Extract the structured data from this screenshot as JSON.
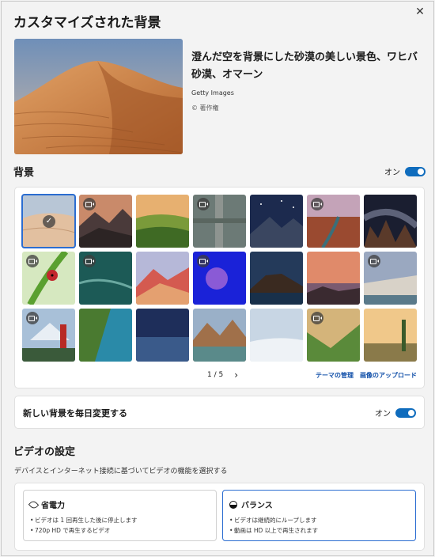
{
  "title": "カスタマイズされた背景",
  "close_label": "✕",
  "hero": {
    "caption": "澄んだ空を背景にした砂漠の美しい景色、ワヒバ砂漠、オマーン",
    "credit": "Getty Images",
    "copyright": "© 著作権"
  },
  "background": {
    "label": "背景",
    "toggle_label": "オン",
    "toggle_on": true,
    "tiles": [
      {
        "id": "desert",
        "video": false,
        "selected": true
      },
      {
        "id": "misty-mountains",
        "video": true
      },
      {
        "id": "green-hills",
        "video": false
      },
      {
        "id": "bridge-aerial",
        "video": true
      },
      {
        "id": "starry-mountain",
        "video": false
      },
      {
        "id": "canyon-river",
        "video": true
      },
      {
        "id": "milky-way-rocks",
        "video": false
      },
      {
        "id": "ladybug",
        "video": true
      },
      {
        "id": "ocean-aerial",
        "video": true
      },
      {
        "id": "rainbow-mountains",
        "video": false
      },
      {
        "id": "jellyfish",
        "video": true
      },
      {
        "id": "coastal-town-night",
        "video": false
      },
      {
        "id": "sunset-rocks",
        "video": false
      },
      {
        "id": "coastal-village",
        "video": true
      },
      {
        "id": "pagoda-fuji",
        "video": true
      },
      {
        "id": "tropical-cliffs",
        "video": false
      },
      {
        "id": "night-lake",
        "video": false
      },
      {
        "id": "mountain-lake",
        "video": false
      },
      {
        "id": "salt-flats",
        "video": false
      },
      {
        "id": "green-valley",
        "video": true
      },
      {
        "id": "cactus-sunset",
        "video": false
      }
    ],
    "pager": "1 / 5",
    "pager_next": "›",
    "manage_themes": "テーマの管理",
    "upload_image": "画像のアップロード"
  },
  "daily": {
    "label": "新しい背景を毎日変更する",
    "toggle_label": "オン",
    "toggle_on": true
  },
  "video": {
    "heading": "ビデオの設定",
    "description": "デバイスとインターネット接続に基づいてビデオの機能を選択する",
    "options": [
      {
        "title": "省電力",
        "lines": [
          "ビデオは 1 回再生した後に停止します",
          "720p HD で再生するビデオ"
        ],
        "selected": false
      },
      {
        "title": "バランス",
        "lines": [
          "ビデオは継続的にループします",
          "動画は HD 以上で再生されます"
        ],
        "selected": true
      }
    ]
  },
  "colors": {
    "accent": "#0f6cbd",
    "link": "#0f4ea8",
    "selected_border": "#2b6dd1"
  }
}
